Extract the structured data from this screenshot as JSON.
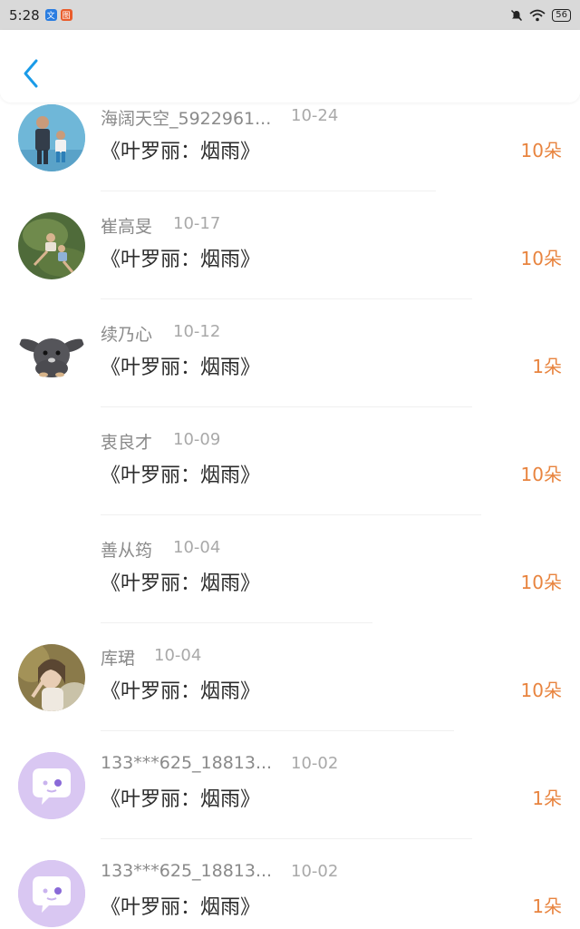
{
  "status_bar": {
    "time": "5:28",
    "battery": "56",
    "app_icon_1_label": "文",
    "app_icon_2_label": "图"
  },
  "rows": [
    {
      "name": "海阔天空_5922961...",
      "date": "10-24",
      "title": "《叶罗丽：烟雨》",
      "amount": "10朵",
      "avatar": "photo-two-people"
    },
    {
      "name": "崔高旻",
      "date": "10-17",
      "title": "《叶罗丽：烟雨》",
      "amount": "10朵",
      "avatar": "photo-kids-grass"
    },
    {
      "name": "续乃心",
      "date": "10-12",
      "title": "《叶罗丽：烟雨》",
      "amount": "1朵",
      "avatar": "photo-rabbit"
    },
    {
      "name": "衷良才",
      "date": "10-09",
      "title": "《叶罗丽：烟雨》",
      "amount": "10朵",
      "avatar": "none"
    },
    {
      "name": "善从筠",
      "date": "10-04",
      "title": "《叶罗丽：烟雨》",
      "amount": "10朵",
      "avatar": "none"
    },
    {
      "name": "库珺",
      "date": "10-04",
      "title": "《叶罗丽：烟雨》",
      "amount": "10朵",
      "avatar": "photo-woman"
    },
    {
      "name": "133***625_18813...",
      "date": "10-02",
      "title": "《叶罗丽：烟雨》",
      "amount": "1朵",
      "avatar": "default-chat-avatar"
    },
    {
      "name": "133***625_18813...",
      "date": "10-02",
      "title": "《叶罗丽：烟雨》",
      "amount": "1朵",
      "avatar": "default-chat-avatar"
    }
  ],
  "colors": {
    "accent": "#1a9be8",
    "amount": "#e8843f",
    "default_avatar": "#d9c7f2"
  }
}
